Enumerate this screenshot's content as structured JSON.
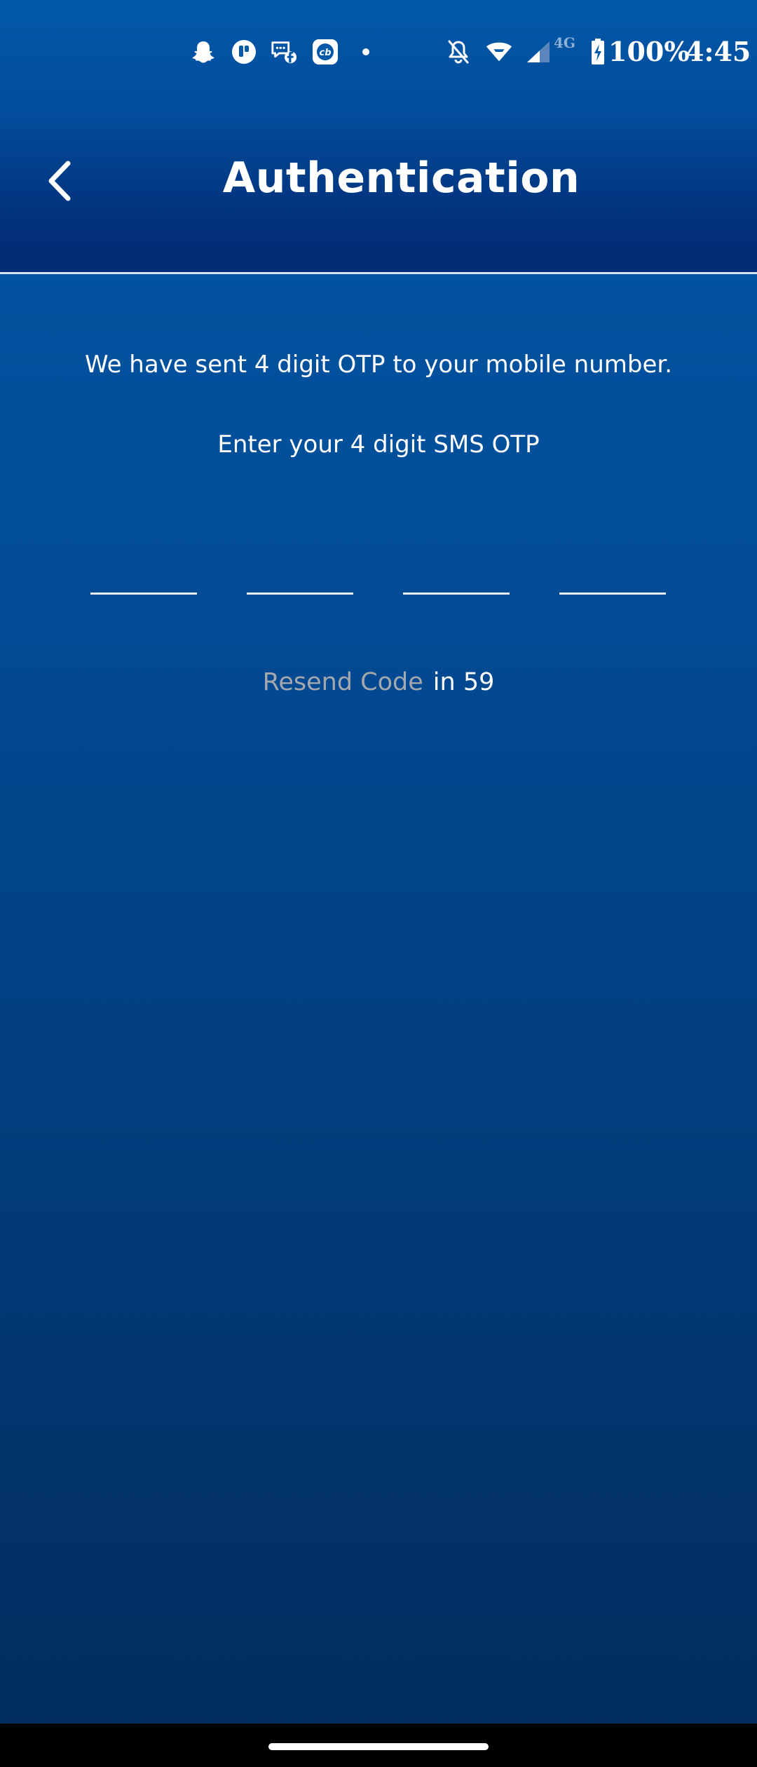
{
  "status_bar": {
    "battery": "100%",
    "time": "4:45",
    "network_type": "4G",
    "icons": [
      "snapchat-icon",
      "t-app-icon",
      "messenger-icon",
      "cb-app-icon",
      "dot-icon",
      "mute-icon",
      "wifi-icon",
      "signal-icon",
      "battery-icon"
    ]
  },
  "header": {
    "title": "Authentication",
    "back_icon": "chevron-left-icon"
  },
  "content": {
    "info": "We have sent 4 digit OTP to your mobile number.",
    "prompt": "Enter your 4 digit SMS OTP",
    "otp_digits": [
      "",
      "",
      "",
      ""
    ],
    "resend_label": "Resend Code",
    "countdown": "in 59"
  },
  "colors": {
    "background_top": "#0259a8",
    "background_bottom": "#022e60",
    "header_dark": "#022d74",
    "resend_disabled": "#a4a8ae",
    "text": "#ffffff"
  }
}
